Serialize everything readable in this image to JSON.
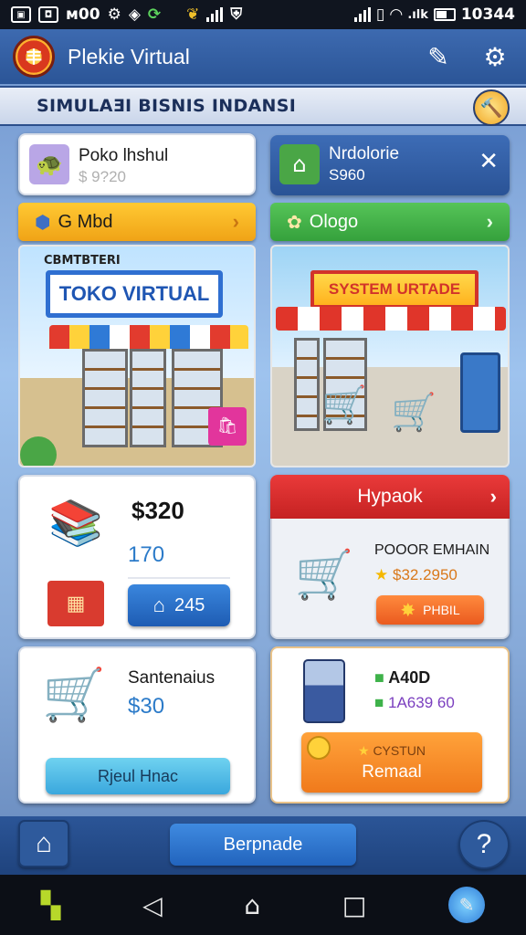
{
  "status_bar": {
    "left": [
      "M",
      "ᴍ00"
    ],
    "time": "10344"
  },
  "header": {
    "title": "Plekie Virtual",
    "logo_glyph": "丰",
    "icons": {
      "edit": "pencil-icon",
      "settings": "gear-icon"
    }
  },
  "banner": {
    "text": "SIMULAƎI BISNIS INDANSI"
  },
  "left_header_card": {
    "name": "Poko lhshul",
    "price": "$ 9?20"
  },
  "right_header_card": {
    "name": "Nrdolorie",
    "price": "S960"
  },
  "left_pill": {
    "label": "G Mbd",
    "color": "#f6b21b"
  },
  "right_pill": {
    "label": "Ologo",
    "color": "#3eb24a"
  },
  "left_scene": {
    "caption": "CBMTBTERI",
    "sign": "TOKO VIRTUAL"
  },
  "right_scene": {
    "sign": "SYSTEM URTADE"
  },
  "left_stats_card": {
    "amount": "$320",
    "count": "170",
    "button_label": "245"
  },
  "upgrade_card": {
    "title": "Hypaok",
    "label": "POOOR EMHAIN",
    "price": "$32.2950",
    "button_label": "PHBIL"
  },
  "cart_card": {
    "title": "Santenaius",
    "price": "$30",
    "button_label": "Rjeul Hnac"
  },
  "atm_card": {
    "value1": "A40D",
    "value2": "1A639 60",
    "badge": "CYSTUN",
    "button_label": "Remaal"
  },
  "bottom_bar": {
    "center_label": "Berpnade"
  }
}
